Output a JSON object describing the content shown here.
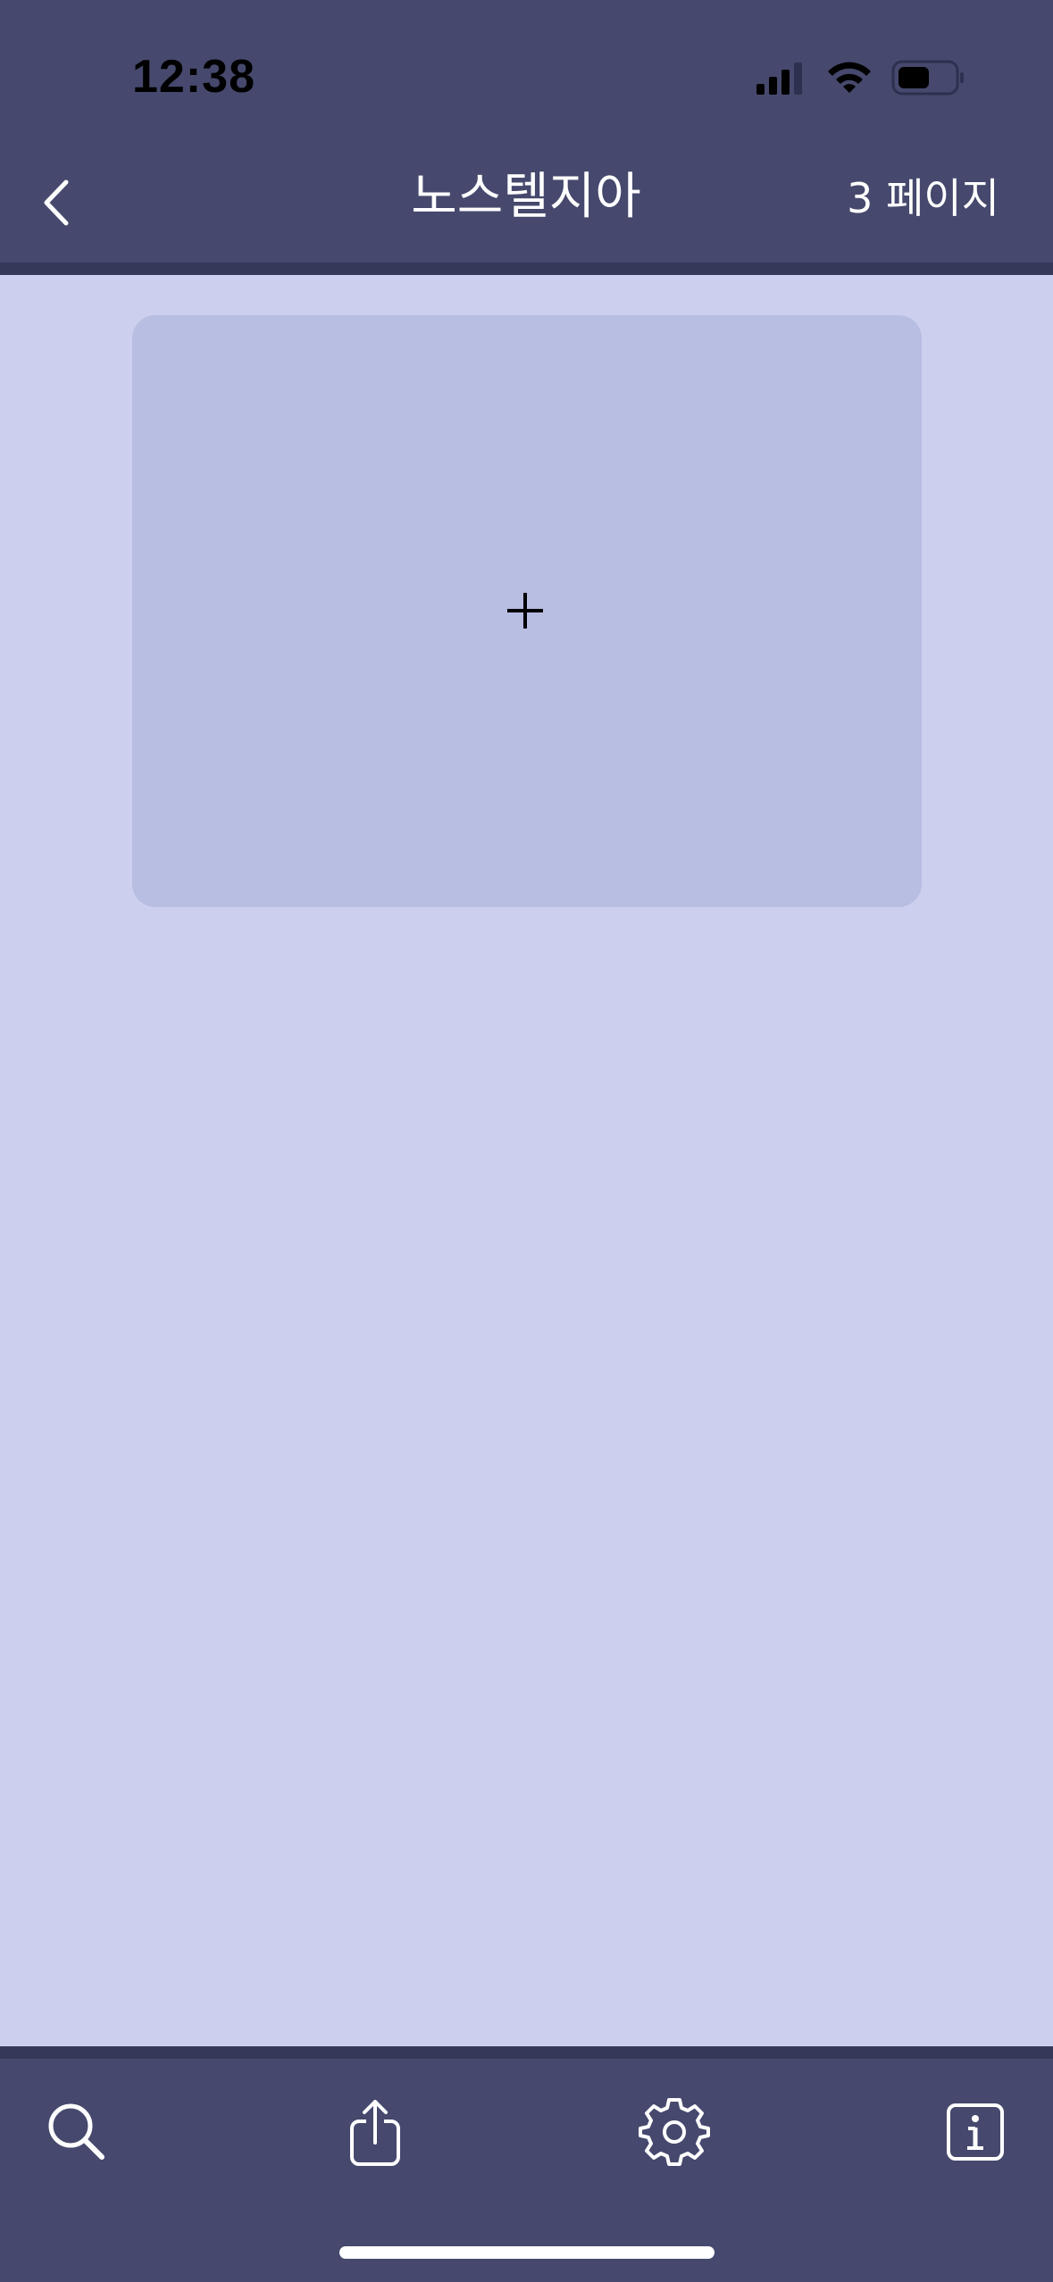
{
  "status_bar": {
    "time": "12:38",
    "icons": [
      "signal-icon",
      "wifi-icon",
      "battery-icon"
    ]
  },
  "nav": {
    "back_icon": "chevron-left-icon",
    "title": "노스텔지아",
    "page_count": "3 페이지"
  },
  "content": {
    "add_card_icon": "plus-icon"
  },
  "tab_bar": {
    "items": [
      {
        "icon": "search-icon"
      },
      {
        "icon": "share-icon"
      },
      {
        "icon": "gear-icon"
      },
      {
        "icon": "info-icon"
      }
    ]
  },
  "colors": {
    "bar_background": "#46496D",
    "bar_divider": "#36385A",
    "page_background": "#CCD0EE",
    "card_background": "#B8BDE2",
    "text_light": "#FFFFFF"
  }
}
